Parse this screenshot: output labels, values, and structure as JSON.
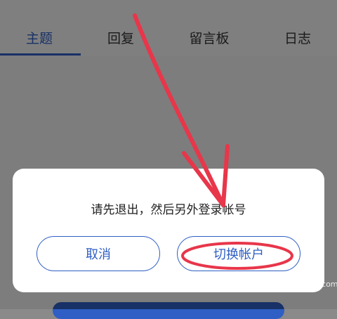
{
  "tabs": [
    {
      "label": "主题",
      "active": true
    },
    {
      "label": "回复",
      "active": false
    },
    {
      "label": "留言板",
      "active": false
    },
    {
      "label": "日志",
      "active": false
    }
  ],
  "dialog": {
    "message": "请先退出，然后另外登录帐号",
    "cancel_label": "取消",
    "switch_label": "切换帐户"
  },
  "colors": {
    "accent": "#2f5ec4",
    "annotation": "#e8364a"
  },
  "watermark": "jingyan.baidu.com"
}
